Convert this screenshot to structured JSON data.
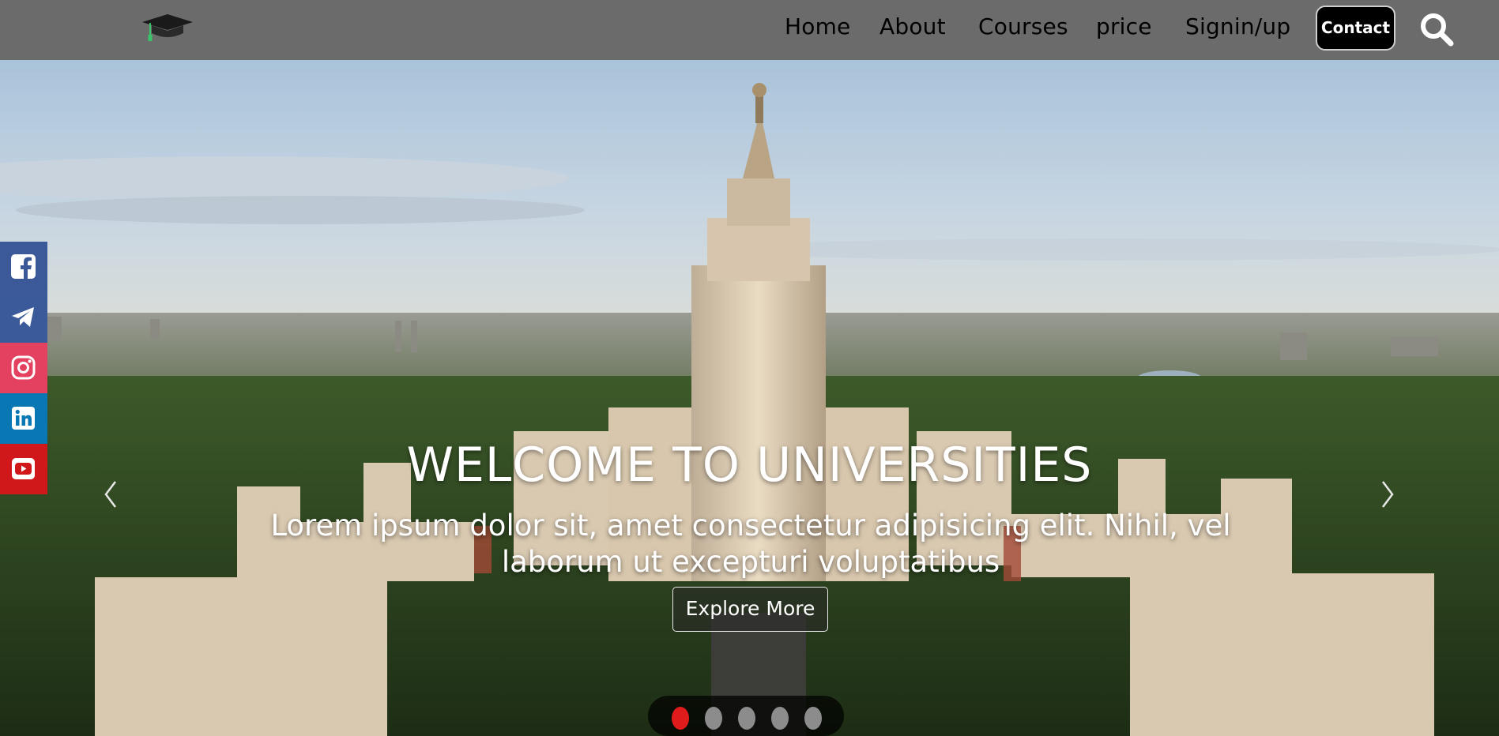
{
  "header": {
    "logo": "graduation-cap-icon",
    "nav": [
      {
        "label": "Home"
      },
      {
        "label": "About"
      },
      {
        "label": "Courses"
      },
      {
        "label": "price"
      },
      {
        "label": "Signin/up"
      }
    ],
    "contact_label": "Contact",
    "search_icon": "search-icon",
    "background": "#6b6b6b"
  },
  "hero": {
    "title": "WELCOME TO UNIVERSITIES",
    "subtitle": "Lorem ipsum dolor sit, amet consectetur adipisicing elit. Nihil, vel laborum ut excepturi voluptatibus",
    "button_label": "Explore More",
    "prev_icon": "chevron-left-icon",
    "next_icon": "chevron-right-icon",
    "slides_total": 5,
    "active_slide": 1,
    "active_dot_color": "#e01b1b",
    "inactive_dot_color": "#8c8c8c"
  },
  "social": [
    {
      "name": "facebook",
      "icon": "facebook-icon",
      "color": "#3b5998"
    },
    {
      "name": "telegram",
      "icon": "telegram-icon",
      "color": "#3a5a9a"
    },
    {
      "name": "instagram",
      "icon": "instagram-icon",
      "color": "#e4405f"
    },
    {
      "name": "linkedin",
      "icon": "linkedin-icon",
      "color": "#0a77b5"
    },
    {
      "name": "youtube",
      "icon": "youtube-icon",
      "color": "#d0181b"
    }
  ]
}
